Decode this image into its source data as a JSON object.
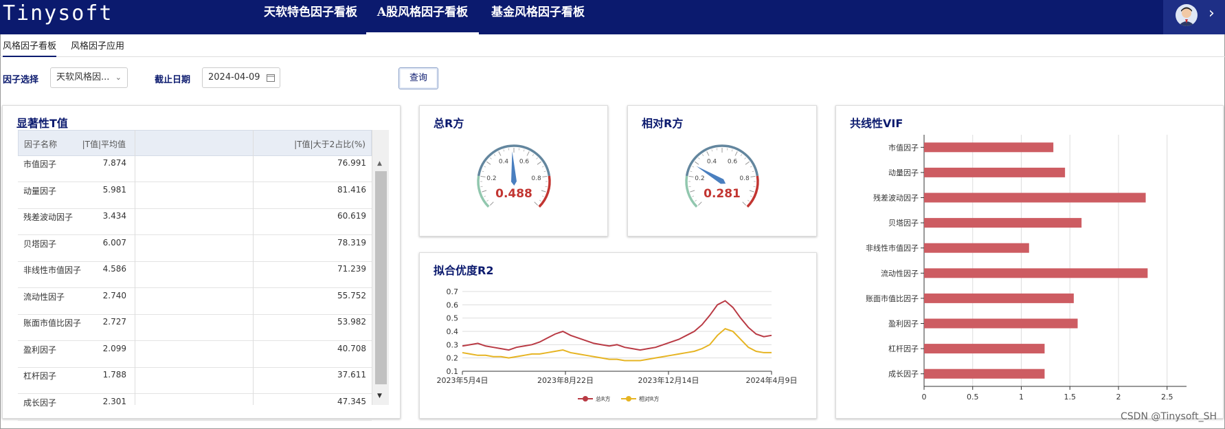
{
  "app": {
    "logo": "Tinysoft"
  },
  "nav": {
    "tabs": [
      {
        "label": "天软特色因子看板"
      },
      {
        "label": "A股风格因子看板"
      },
      {
        "label": "基金风格因子看板"
      }
    ]
  },
  "subtabs": {
    "items": [
      {
        "label": "风格因子看板"
      },
      {
        "label": "风格因子应用"
      }
    ]
  },
  "filters": {
    "factor_label": "因子选择",
    "factor_value": "天软风格因...",
    "date_label": "截止日期",
    "date_value": "2024-04-09",
    "query_label": "查询"
  },
  "tvalue": {
    "title": "显著性T值",
    "headers": [
      "因子名称",
      "|T值|平均值",
      "|T值|大于2占比(%)"
    ],
    "rows": [
      {
        "name": "市值因子",
        "mean": "7.874",
        "ratio": "76.991"
      },
      {
        "name": "动量因子",
        "mean": "5.981",
        "ratio": "81.416"
      },
      {
        "name": "残差波动因子",
        "mean": "3.434",
        "ratio": "60.619"
      },
      {
        "name": "贝塔因子",
        "mean": "6.007",
        "ratio": "78.319"
      },
      {
        "name": "非线性市值因子",
        "mean": "4.586",
        "ratio": "71.239"
      },
      {
        "name": "流动性因子",
        "mean": "2.740",
        "ratio": "55.752"
      },
      {
        "name": "账面市值比因子",
        "mean": "2.727",
        "ratio": "53.982"
      },
      {
        "name": "盈利因子",
        "mean": "2.099",
        "ratio": "40.708"
      },
      {
        "name": "杠杆因子",
        "mean": "1.788",
        "ratio": "37.611"
      },
      {
        "name": "成长因子",
        "mean": "2.301",
        "ratio": "47.345"
      }
    ]
  },
  "gauges": {
    "total": {
      "title": "总R方",
      "value": 0.488,
      "display": "0.488",
      "ticks": [
        "0.2",
        "0.4",
        "0.6",
        "0.8"
      ]
    },
    "relative": {
      "title": "相对R方",
      "value": 0.281,
      "display": "0.281",
      "ticks": [
        "0.2",
        "0.4",
        "0.6",
        "0.8"
      ]
    }
  },
  "r2": {
    "title": "拟合优度R2",
    "chart_data": {
      "type": "line",
      "x_labels": [
        "2023年5月4日",
        "2023年8月22日",
        "2023年12月14日",
        "2024年4月9日"
      ],
      "y_ticks": [
        "0.1",
        "0.2",
        "0.3",
        "0.4",
        "0.5",
        "0.6",
        "0.7"
      ],
      "ylim": [
        0.1,
        0.7
      ],
      "series": [
        {
          "name": "总R方",
          "color": "#b93a44",
          "values": [
            0.29,
            0.3,
            0.31,
            0.29,
            0.28,
            0.27,
            0.26,
            0.28,
            0.29,
            0.3,
            0.32,
            0.35,
            0.38,
            0.4,
            0.37,
            0.35,
            0.33,
            0.31,
            0.3,
            0.29,
            0.3,
            0.28,
            0.27,
            0.26,
            0.27,
            0.28,
            0.3,
            0.32,
            0.34,
            0.37,
            0.4,
            0.45,
            0.52,
            0.6,
            0.63,
            0.58,
            0.5,
            0.43,
            0.38,
            0.36,
            0.37
          ]
        },
        {
          "name": "相对R方",
          "color": "#e6b422",
          "values": [
            0.24,
            0.23,
            0.22,
            0.22,
            0.21,
            0.21,
            0.2,
            0.21,
            0.22,
            0.23,
            0.23,
            0.24,
            0.25,
            0.26,
            0.24,
            0.23,
            0.22,
            0.21,
            0.2,
            0.19,
            0.19,
            0.18,
            0.18,
            0.18,
            0.19,
            0.2,
            0.21,
            0.22,
            0.23,
            0.24,
            0.25,
            0.27,
            0.3,
            0.37,
            0.42,
            0.4,
            0.34,
            0.28,
            0.25,
            0.24,
            0.24
          ]
        }
      ]
    }
  },
  "vif": {
    "title": "共线性VIF",
    "chart_data": {
      "type": "bar",
      "orientation": "horizontal",
      "categories": [
        "市值因子",
        "动量因子",
        "残差波动因子",
        "贝塔因子",
        "非线性市值因子",
        "流动性因子",
        "账面市值比因子",
        "盈利因子",
        "杠杆因子",
        "成长因子"
      ],
      "values": [
        1.33,
        1.45,
        2.28,
        1.62,
        1.08,
        2.3,
        1.54,
        1.58,
        1.24,
        1.24
      ],
      "x_ticks": [
        "0",
        "0.5",
        "1",
        "1.5",
        "2",
        "2.5"
      ],
      "xlim": [
        0,
        2.7
      ],
      "color": "#cd5c62"
    }
  },
  "watermark": "CSDN @Tinysoft_SH"
}
